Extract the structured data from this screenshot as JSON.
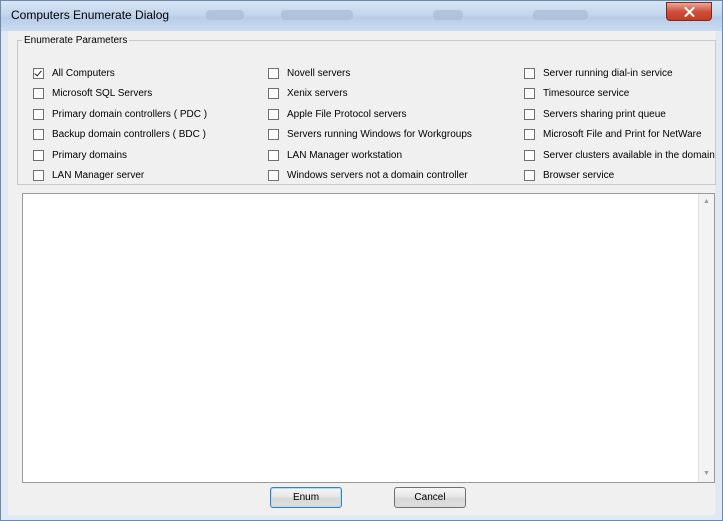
{
  "window": {
    "title": "Computers Enumerate Dialog"
  },
  "group": {
    "legend": "Enumerate Parameters"
  },
  "options": [
    {
      "label": "All Computers",
      "checked": true
    },
    {
      "label": "Microsoft SQL Servers",
      "checked": false
    },
    {
      "label": "Primary domain controllers ( PDC )",
      "checked": false
    },
    {
      "label": "Backup domain controllers ( BDC )",
      "checked": false
    },
    {
      "label": "Primary domains",
      "checked": false
    },
    {
      "label": "LAN Manager server",
      "checked": false
    },
    {
      "label": "Novell servers",
      "checked": false
    },
    {
      "label": "Xenix servers",
      "checked": false
    },
    {
      "label": "Apple File Protocol servers",
      "checked": false
    },
    {
      "label": "Servers running Windows for Workgroups",
      "checked": false
    },
    {
      "label": "LAN Manager workstation",
      "checked": false
    },
    {
      "label": "Windows servers not a domain controller",
      "checked": false
    },
    {
      "label": "Server running dial-in service",
      "checked": false
    },
    {
      "label": "Timesource service",
      "checked": false
    },
    {
      "label": "Servers sharing print queue",
      "checked": false
    },
    {
      "label": "Microsoft File and Print for NetWare",
      "checked": false
    },
    {
      "label": "Server clusters available in the domain",
      "checked": false
    },
    {
      "label": "Browser service",
      "checked": false
    }
  ],
  "results": [],
  "buttons": {
    "enum_label": "Enum",
    "cancel_label": "Cancel"
  },
  "icons": {
    "close": "close-icon",
    "scroll_up": "scroll-up-arrow-icon",
    "scroll_down": "scroll-down-arrow-icon"
  },
  "colors": {
    "title_bar": "#c3d6ee",
    "close_button": "#c43b25",
    "dialog_background": "#f0f0f0"
  }
}
